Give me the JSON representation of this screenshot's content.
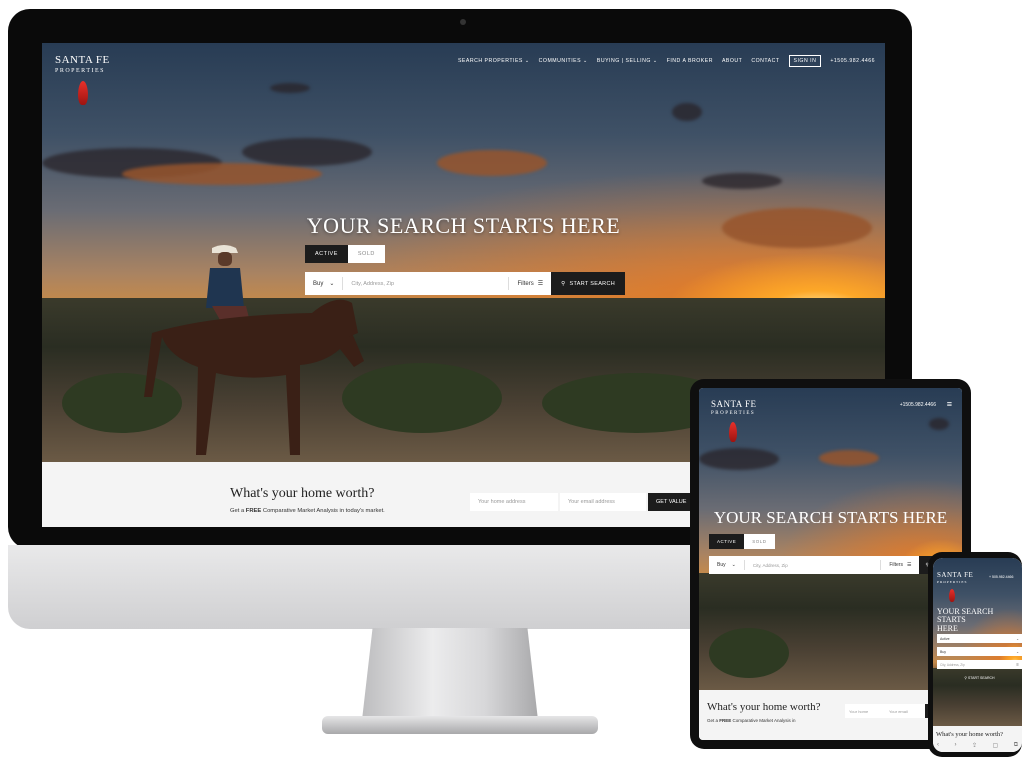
{
  "brand": {
    "line1": "SANTA FE",
    "line2": "PROPERTIES"
  },
  "nav": {
    "items": [
      "SEARCH PROPERTIES ⌄",
      "COMMUNITIES ⌄",
      "BUYING | SELLING ⌄",
      "FIND A BROKER",
      "ABOUT",
      "CONTACT"
    ],
    "signin": "SIGN IN",
    "phone": "+1505.982.4466"
  },
  "hero": {
    "title": "YOUR SEARCH STARTS HERE",
    "tab_active": "ACTIVE",
    "tab_sold": "SOLD",
    "buy": "Buy",
    "placeholder": "City, Address, Zip",
    "filters": "Filters",
    "start_search": "START SEARCH"
  },
  "worth": {
    "title": "What's your home worth?",
    "sub_pre": "Get a ",
    "sub_free": "FREE",
    "sub_post": " Comparative Market Analysis in today's market.",
    "home_address": "Your home address",
    "email": "Your email address",
    "get_value": "GET VALUE"
  },
  "tablet": {
    "phone": "+1505.982.4466",
    "tab_active": "ACTIVE",
    "tab_sold": "SOLD",
    "buy": "Buy",
    "placeholder": "City, Address, Zip",
    "filters": "Filters",
    "start_search": "START SE",
    "worth_title": "What's your home worth?",
    "worth_sub_pre": "Get a ",
    "worth_sub_free": "FREE",
    "worth_sub_post": " Comparative Market Analysis in",
    "home_address": "Your home",
    "email": "Your email"
  },
  "phone": {
    "contact": "+ 505.982.4466",
    "title_line1": "YOUR SEARCH STARTS",
    "title_line2": "HERE",
    "sel_status": "Active",
    "sel_type": "Buy",
    "placeholder": "City, Address, Zip",
    "start_search": "START SEARCH",
    "worth_title": "What's your home worth?"
  },
  "colors": {
    "accent_dark": "#1c1c1c",
    "feather_red": "#e8302a",
    "band_gray": "#f4f4f4"
  }
}
